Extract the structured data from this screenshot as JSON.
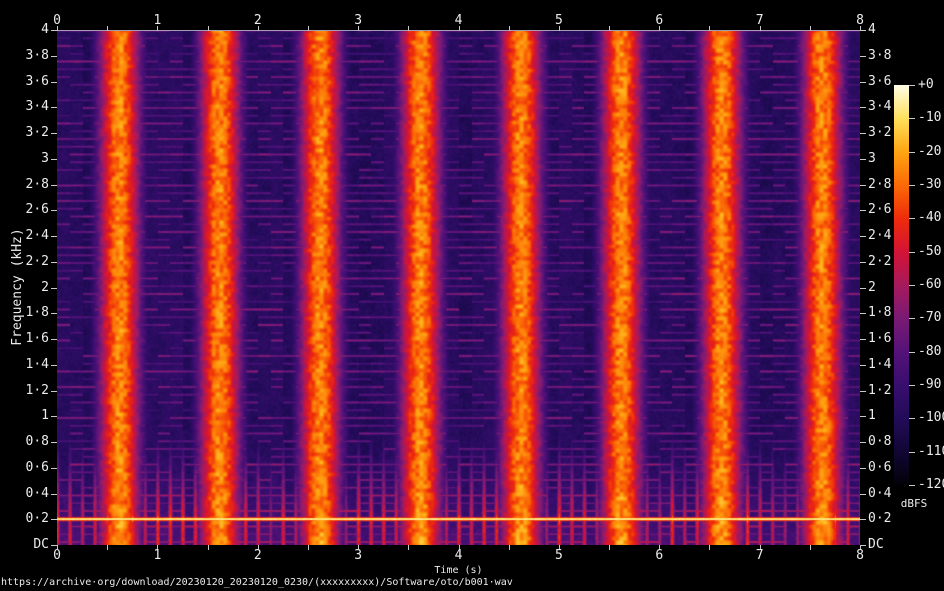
{
  "page": {
    "background": "#000000",
    "source_caption": "https://archive·org/download/20230120_20230120_0230/(xxxxxxxxx)/Software/oto/b001·wav"
  },
  "chart_data": {
    "type": "heatmap",
    "subtype": "audio-spectrogram",
    "title": "",
    "xlabel": "Time (s)",
    "ylabel": "Frequency (kHz)",
    "x_range_s": [
      0,
      8
    ],
    "y_range_khz": [
      0,
      4
    ],
    "grid": false,
    "x_ticks": {
      "major_labels": [
        "0",
        "1",
        "2",
        "3",
        "4",
        "5",
        "6",
        "7",
        "8"
      ],
      "major_values": [
        0,
        1,
        2,
        3,
        4,
        5,
        6,
        7,
        8
      ],
      "minor_step_s": 0.5,
      "shown_on": [
        "top",
        "bottom"
      ]
    },
    "y_ticks": {
      "labels": [
        "4",
        "3·8",
        "3·6",
        "3·4",
        "3·2",
        "3",
        "2·8",
        "2·6",
        "2·4",
        "2·2",
        "2",
        "1·8",
        "1·6",
        "1·4",
        "1·2",
        "1",
        "0·8",
        "0·6",
        "0·4",
        "0·2",
        "DC"
      ],
      "values_khz": [
        4,
        3.8,
        3.6,
        3.4,
        3.2,
        3,
        2.8,
        2.6,
        2.4,
        2.2,
        2,
        1.8,
        1.6,
        1.4,
        1.2,
        1,
        0.8,
        0.6,
        0.4,
        0.2,
        0
      ],
      "shown_on": [
        "left",
        "right"
      ]
    },
    "colorbar": {
      "unit": "dBFS",
      "tick_labels": [
        "+0",
        "-10",
        "-20",
        "-30",
        "-40",
        "-50",
        "-60",
        "-70",
        "-80",
        "-90",
        "-100",
        "-110",
        "-120"
      ],
      "tick_values_db": [
        0,
        -10,
        -20,
        -30,
        -40,
        -50,
        -60,
        -70,
        -80,
        -90,
        -100,
        -110,
        -120
      ],
      "stops": [
        {
          "db": 0,
          "color": "#fffde8"
        },
        {
          "db": -10,
          "color": "#ffe15c"
        },
        {
          "db": -20,
          "color": "#ffa512"
        },
        {
          "db": -30,
          "color": "#fb6a06"
        },
        {
          "db": -40,
          "color": "#ee2c0b"
        },
        {
          "db": -50,
          "color": "#d41335"
        },
        {
          "db": -60,
          "color": "#a61a5c"
        },
        {
          "db": -70,
          "color": "#7a1a74"
        },
        {
          "db": -80,
          "color": "#551278"
        },
        {
          "db": -90,
          "color": "#380e6e"
        },
        {
          "db": -100,
          "color": "#230b59"
        },
        {
          "db": -110,
          "color": "#110634"
        },
        {
          "db": -120,
          "color": "#030108"
        }
      ]
    },
    "pattern": {
      "description": "Rhythmic loop: broadband noise burst once per second, ~60 Hz-spaced harmonic stripes, continuous ~0.2 kHz bass tone near 0 dBFS with percussive flares every eighth note",
      "noise_burst_period_s": 1.0,
      "noise_burst_center_offset_s": 0.62,
      "noise_burst_sigma_s": 0.105,
      "noise_burst_peak_db": -30,
      "harmonic_spacing_px": 7.75,
      "harmonic_level_db": -70,
      "background_level_db": -104,
      "bass_tone_khz": 0.205,
      "bass_tone_level_db": -3,
      "beat_interval_s": 0.125,
      "low_band_max_khz": 1.15,
      "seed": 42
    }
  }
}
